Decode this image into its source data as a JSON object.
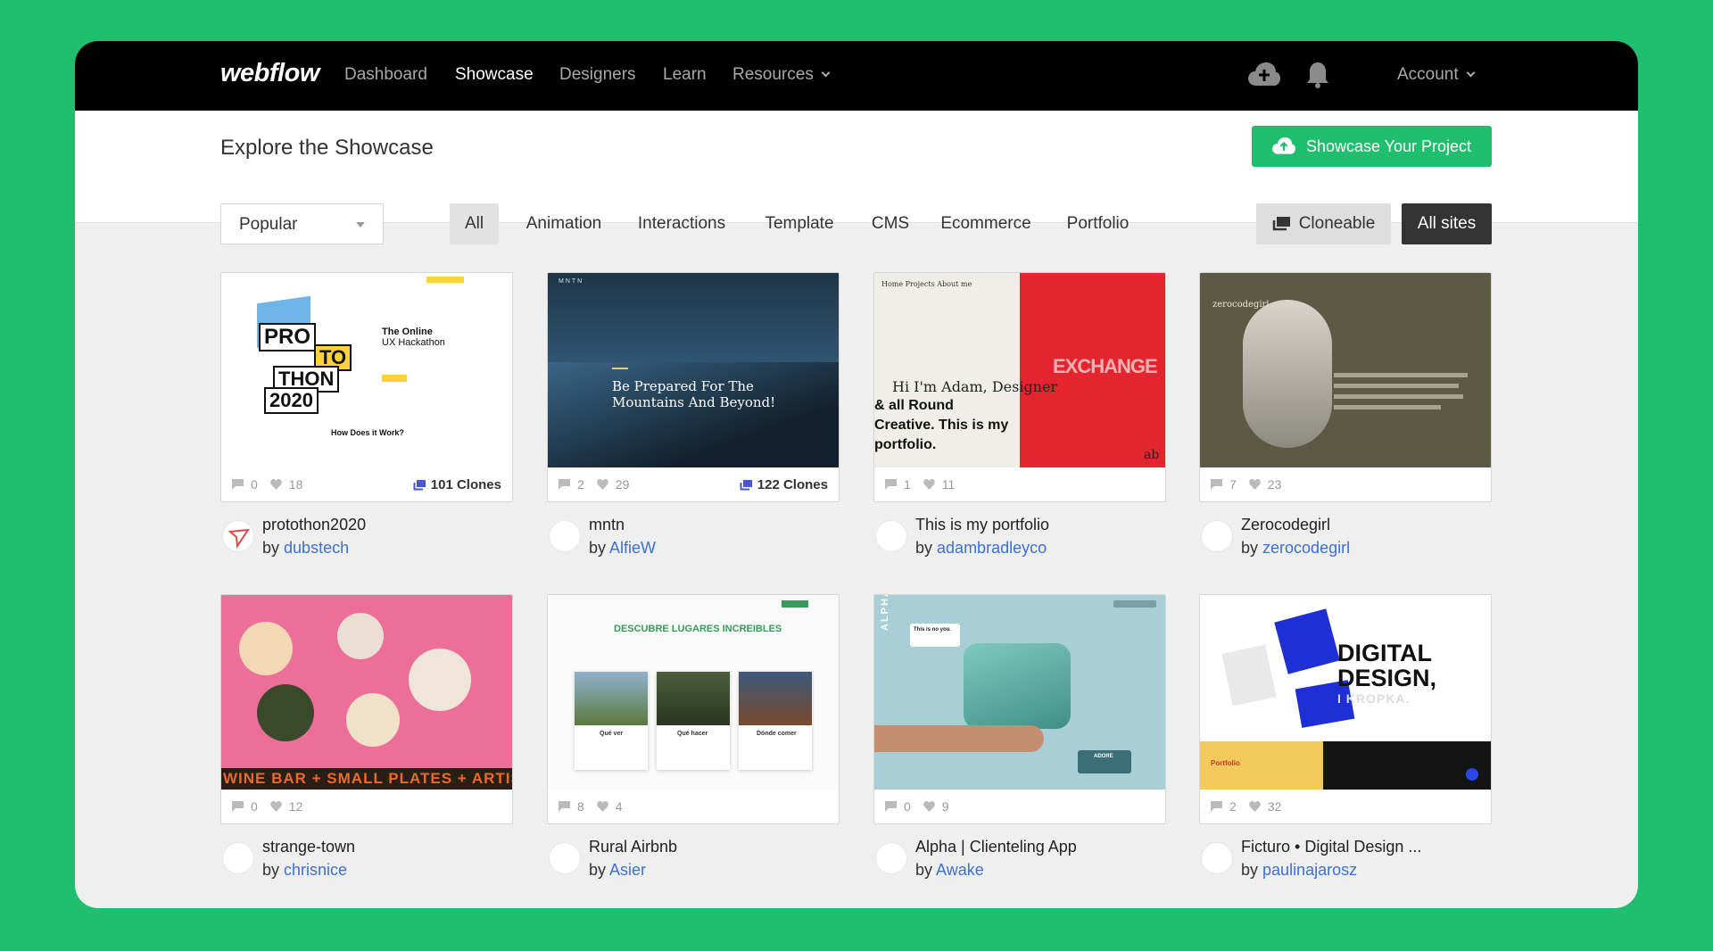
{
  "nav": {
    "logo": "webflow",
    "links": [
      "Dashboard",
      "Showcase",
      "Designers",
      "Learn",
      "Resources"
    ],
    "active": "Showcase",
    "account": "Account",
    "icons": [
      "cloud-upload-icon",
      "bell-icon",
      "chevron-down-icon"
    ]
  },
  "header": {
    "title": "Explore the Showcase",
    "cta_label": "Showcase Your Project"
  },
  "filters": {
    "sort_value": "Popular",
    "categories": [
      "All",
      "Animation",
      "Interactions",
      "Template",
      "CMS",
      "Ecommerce",
      "Portfolio"
    ],
    "active_category": "All",
    "cloneable_label": "Cloneable",
    "all_sites_label": "All sites"
  },
  "colors": {
    "brand_green": "#1fbf6f",
    "link_blue": "#3b6fd9",
    "nav_bg": "#000000"
  },
  "cards": [
    {
      "name": "protothon2020",
      "author": "dubstech",
      "comments": "0",
      "likes": "18",
      "clones": "101 Clones",
      "thumb": {
        "lines": [
          "The Online",
          "UX Hackathon",
          "PRO",
          "TO",
          "THON",
          "2020",
          "How Does it Work?"
        ]
      }
    },
    {
      "name": "mntn",
      "author": "AlfieW",
      "comments": "2",
      "likes": "29",
      "clones": "122 Clones",
      "thumb": {
        "lines": [
          "MNTN",
          "Be Prepared For The",
          "Mountains And Beyond!"
        ]
      }
    },
    {
      "name": "This is my portfolio",
      "author": "adambradleyco",
      "comments": "1",
      "likes": "11",
      "clones": "",
      "thumb": {
        "lines": [
          "Home  Projects  About me",
          "Hi I'm Adam, Designer",
          "& all Round",
          "Creative. This is my",
          "portfolio.",
          "EXCHANGE",
          "ab"
        ]
      }
    },
    {
      "name": "Zerocodegirl",
      "author": "zerocodegirl",
      "comments": "7",
      "likes": "23",
      "clones": "",
      "thumb": {
        "lines": [
          "zerocodegirl"
        ]
      }
    },
    {
      "name": "strange-town",
      "author": "chrisnice",
      "comments": "0",
      "likes": "12",
      "clones": "",
      "thumb": {
        "lines": [
          "WINE BAR + SMALL PLATES + ARTISAN"
        ]
      }
    },
    {
      "name": "Rural Airbnb",
      "author": "Asier",
      "comments": "8",
      "likes": "4",
      "clones": "",
      "thumb": {
        "lines": [
          "DESCUBRE LUGARES INCREIBLES",
          "Qué ver",
          "Qué hacer",
          "Dónde comer"
        ]
      }
    },
    {
      "name": "Alpha | Clienteling App",
      "author": "Awake",
      "comments": "0",
      "likes": "9",
      "clones": "",
      "thumb": {
        "lines": [
          "ALPHA",
          "This is no you.",
          "ADORE"
        ]
      }
    },
    {
      "name": "Ficturo • Digital Design ...",
      "author": "paulinajarosz",
      "comments": "2",
      "likes": "32",
      "clones": "",
      "thumb": {
        "lines": [
          "DIGITAL",
          "DESIGN,",
          "I KROPKA.",
          "Portfolio"
        ]
      }
    }
  ],
  "by_prefix": "by"
}
